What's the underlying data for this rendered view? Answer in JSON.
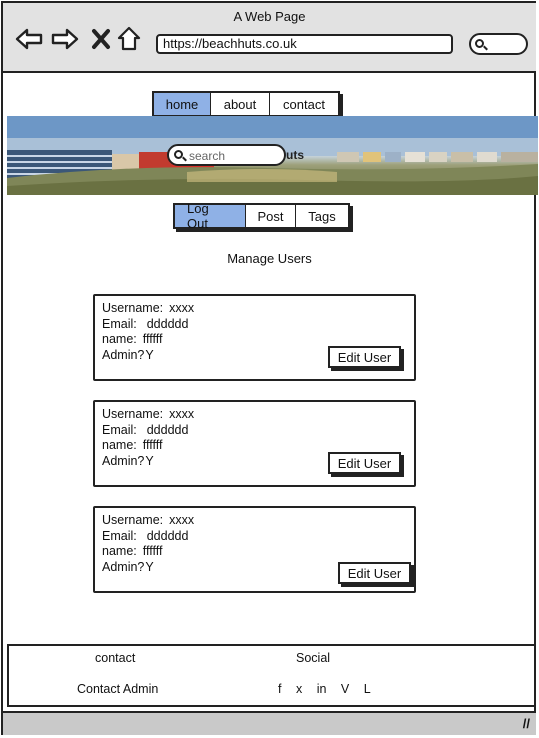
{
  "browser": {
    "title": "A Web Page",
    "url": "https://beachhuts.co.uk",
    "icons": [
      "back-arrow-icon",
      "forward-arrow-icon",
      "close-x-icon",
      "home-icon",
      "search-icon"
    ]
  },
  "nav": {
    "tabs": [
      {
        "label": "home",
        "active": true
      },
      {
        "label": "about",
        "active": false
      },
      {
        "label": "contact",
        "active": false
      }
    ]
  },
  "hero": {
    "search_placeholder": "search",
    "overlay_text": "uts"
  },
  "user_nav": {
    "tabs": [
      {
        "label": "Log Out",
        "active": true
      },
      {
        "label": "Post",
        "active": false
      },
      {
        "label": "Tags",
        "active": false
      }
    ]
  },
  "page_title": "Manage Users",
  "users": [
    {
      "username_label": "Username:",
      "username": "xxxx",
      "email_label": "Email:",
      "email": "dddddd",
      "name_label": "name:",
      "name": "ffffff",
      "admin_label": "Admin?",
      "admin": "Y",
      "button": "Edit User"
    },
    {
      "username_label": "Username:",
      "username": "xxxx",
      "email_label": "Email:",
      "email": "dddddd",
      "name_label": "name:",
      "name": "ffffff",
      "admin_label": "Admin?",
      "admin": "Y",
      "button": "Edit User"
    },
    {
      "username_label": "Username:",
      "username": "xxxx",
      "email_label": "Email:",
      "email": "dddddd",
      "name_label": "name:",
      "name": "ffffff",
      "admin_label": "Admin?",
      "admin": "Y",
      "button": "Edit User"
    }
  ],
  "footer": {
    "contact_heading": "contact",
    "contact_link": "Contact Admin",
    "social_heading": "Social",
    "social_links": [
      "f",
      "x",
      "in",
      "V",
      "L"
    ]
  },
  "colors": {
    "active_tab": "#8fb1e6",
    "chrome": "#e2e2e2",
    "status_bar": "#c9c9c9"
  }
}
